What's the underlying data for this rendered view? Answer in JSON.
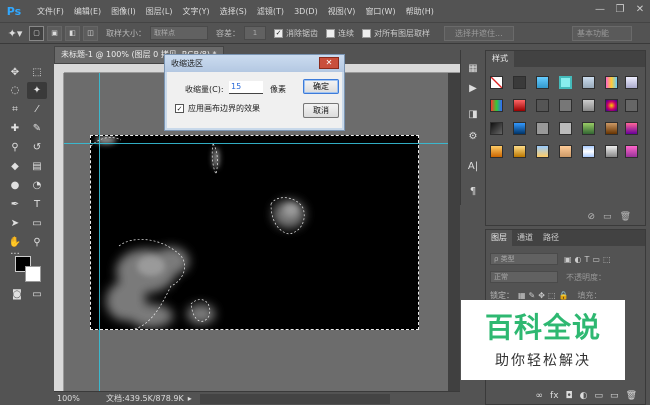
{
  "app": {
    "logo": "Ps",
    "menu": [
      "文件(F)",
      "编辑(E)",
      "图像(I)",
      "图层(L)",
      "文字(Y)",
      "选择(S)",
      "滤镜(T)",
      "3D(D)",
      "视图(V)",
      "窗口(W)",
      "帮助(H)"
    ],
    "window_controls": {
      "minimize": "—",
      "restore": "❐",
      "close": "✕"
    }
  },
  "options_bar": {
    "sample_size_label": "取样大小：",
    "sample_size_value": "取样点",
    "tolerance_label": "容差：",
    "tolerance_value": "1",
    "anti_alias_label": "消除锯齿",
    "anti_alias_checked": "✓",
    "contiguous_label": "连续",
    "contiguous_checked": "",
    "sample_all_label": "对所有图层取样",
    "sample_all_checked": "",
    "select_mask_button": "选择并遮住...",
    "workspace": "基本功能"
  },
  "document": {
    "tab_title": "未标题-1 @ 100% (图层 0 拷贝, RGB/8) *",
    "zoom": "100%",
    "doc_info": "文档:439.5K/878.9K",
    "status_arrow": "▸"
  },
  "dialog": {
    "title": "收缩选区",
    "close_label": "✕",
    "amount_label": "收缩量(C):",
    "amount_value": "15",
    "unit": "像素",
    "apply_edge_label": "应用画布边界的效果",
    "apply_edge_checked": "✓",
    "ok_button": "确定",
    "cancel_button": "取消"
  },
  "styles_panel": {
    "tab": "样式",
    "footer_icons": [
      "⊘",
      "▭",
      "🗑"
    ]
  },
  "layers_panel": {
    "tabs": [
      "图层",
      "通道",
      "路径"
    ],
    "kind_label": "ρ 类型",
    "blend_mode": "正常",
    "opacity_label": "不透明度：",
    "lock_label": "锁定：",
    "fill_label": "填充：",
    "footer_icons": [
      "∞",
      "fx",
      "◘",
      "◐",
      "▭",
      "▭",
      "🗑"
    ]
  },
  "watermark": {
    "title": "百科全说",
    "subtitle": "助你轻松解决"
  },
  "colors": {
    "accent_guide": "#36c0d8",
    "watermark_green": "#2eb871",
    "ps_blue": "#31a8ff"
  }
}
